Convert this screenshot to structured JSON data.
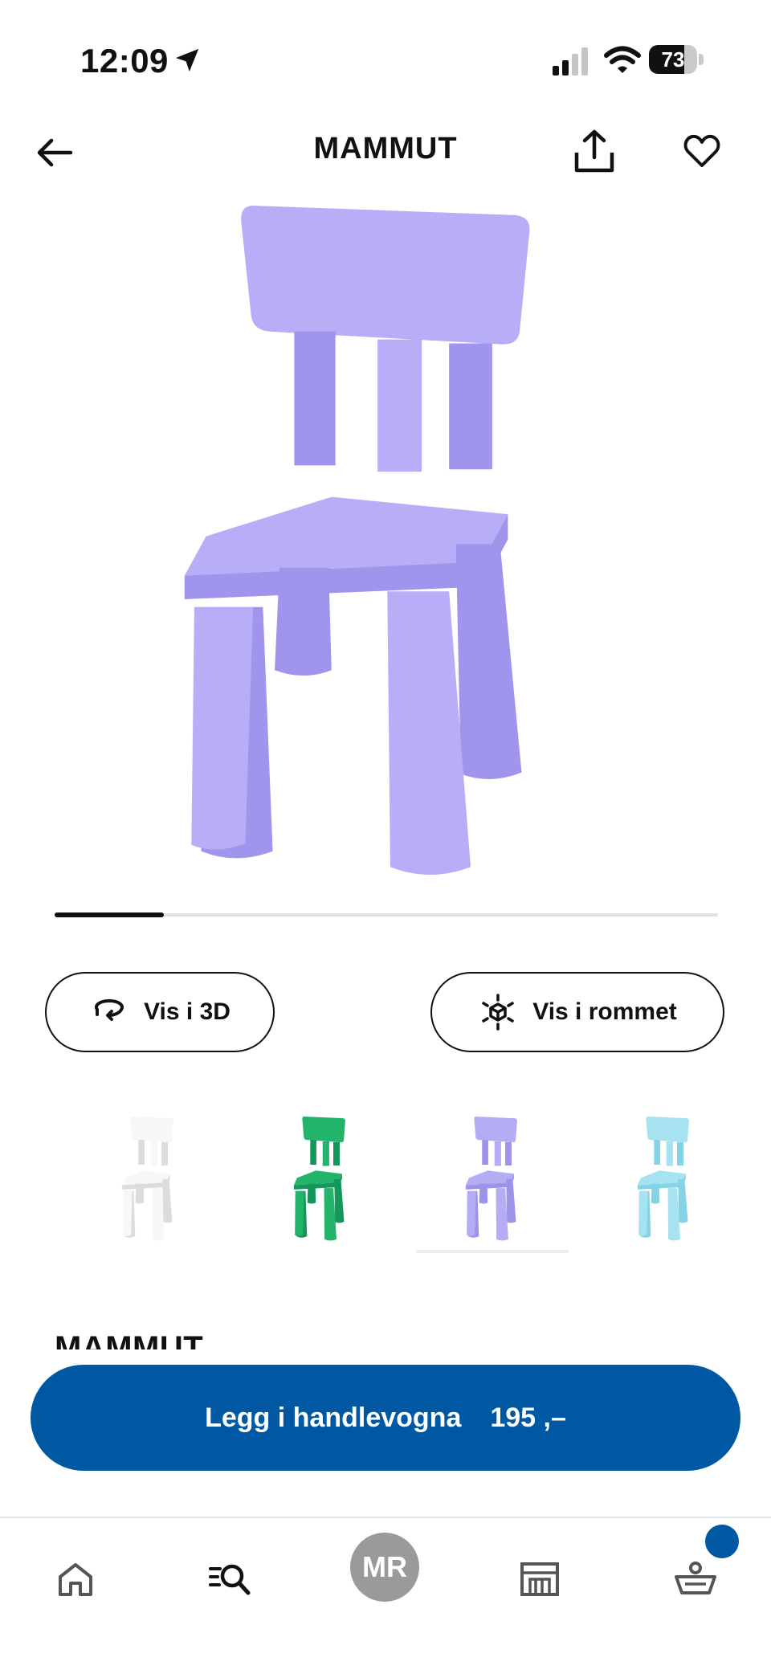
{
  "status_bar": {
    "time": "12:09",
    "battery_percent": "73"
  },
  "header": {
    "title": "MAMMUT"
  },
  "buttons": {
    "view_3d": "Vis i 3D",
    "view_room": "Vis i rommet"
  },
  "gallery": {
    "current_index": 1,
    "total": 6
  },
  "variants": [
    {
      "color": "#f7f7f7",
      "shade": "#dcdcdc",
      "name": "white"
    },
    {
      "color": "#22b46a",
      "shade": "#14975a",
      "name": "green"
    },
    {
      "color": "#b5adf4",
      "shade": "#9d93ea",
      "name": "lilac"
    },
    {
      "color": "#a6e2ef",
      "shade": "#84d3e6",
      "name": "light-blue"
    }
  ],
  "product": {
    "name": "MAMMUT",
    "color": "#b7aef7",
    "shade": "#9f95ec"
  },
  "cart_cta": {
    "label": "Legg i handlevogna",
    "price": "195 ,–"
  },
  "nav": {
    "avatar_initials": "MR"
  },
  "theme": {
    "brand_blue": "#0058A3"
  }
}
